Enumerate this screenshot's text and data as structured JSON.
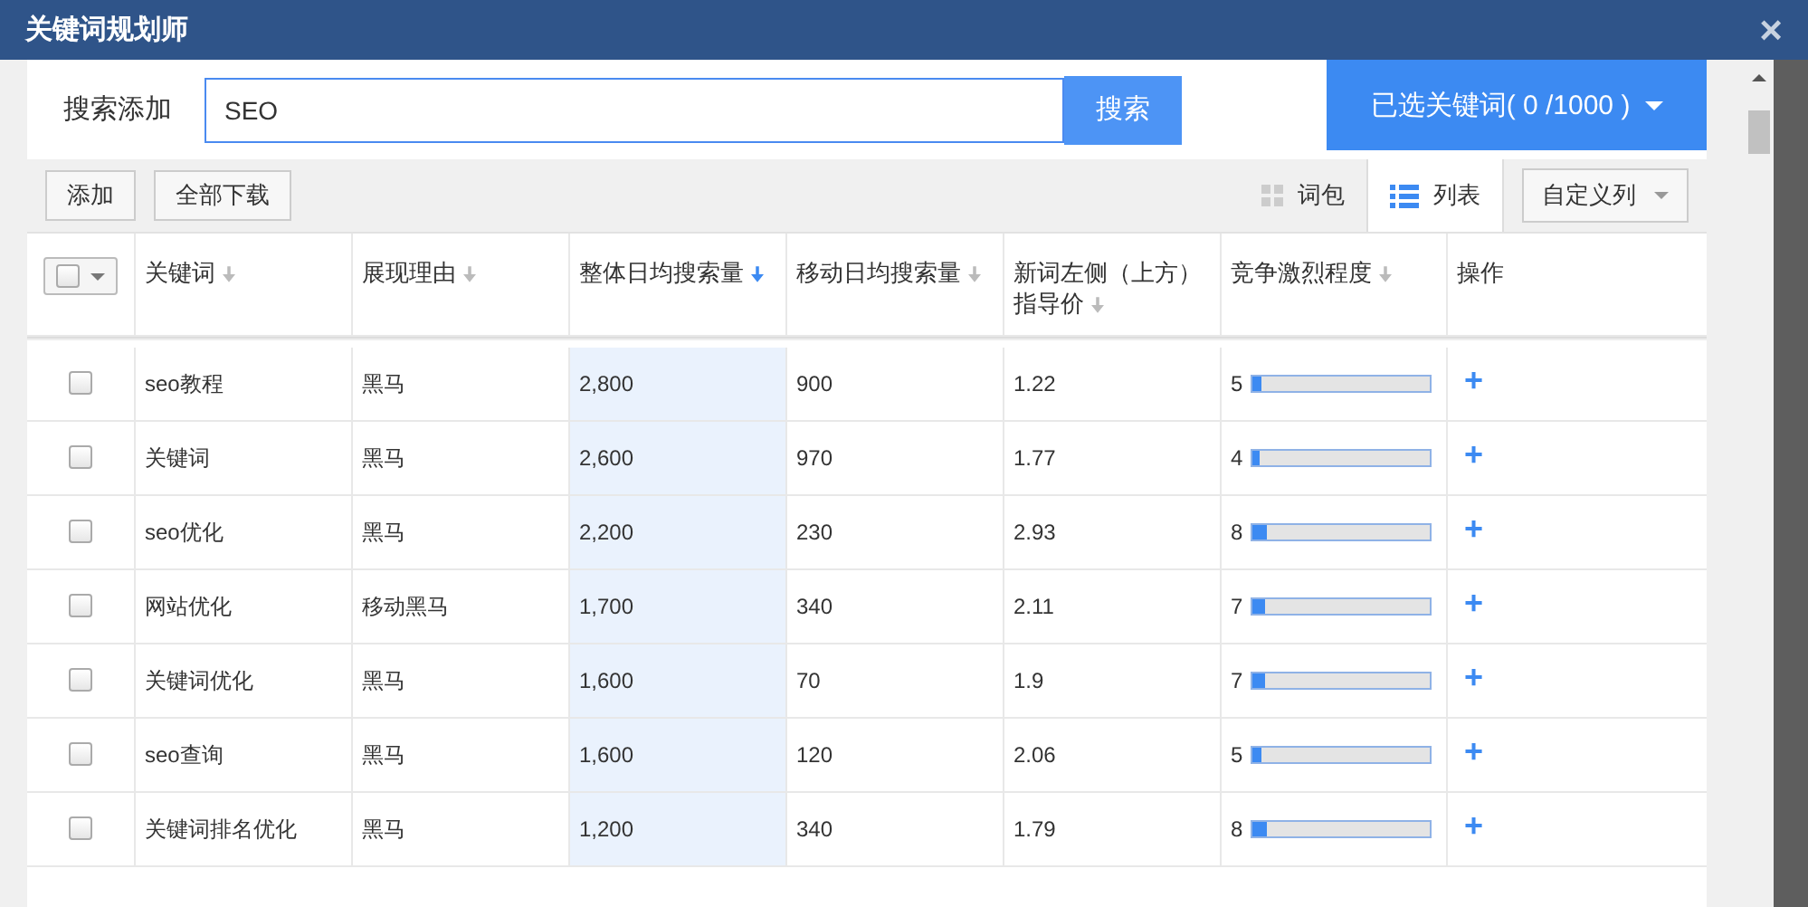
{
  "window": {
    "title": "关键词规划师",
    "close": "×"
  },
  "search": {
    "label": "搜索添加",
    "value": "SEO",
    "button": "搜索",
    "selected_summary": "已选关键词( 0 /1000 )"
  },
  "toolbar": {
    "buttons": [
      "添加",
      "全部下载"
    ],
    "views": [
      {
        "label": "词包",
        "kind": "grid",
        "selected": false
      },
      {
        "label": "列表",
        "kind": "list",
        "selected": true
      }
    ],
    "columns_menu": "自定义列"
  },
  "table": {
    "select_all": {
      "checked": false
    },
    "columns": [
      {
        "label": "关键词",
        "sortable": true,
        "sorted": false
      },
      {
        "label": "展现理由",
        "sortable": true,
        "sorted": false
      },
      {
        "label": "整体日均搜索量",
        "sortable": true,
        "sorted": true
      },
      {
        "label": "移动日均搜索量",
        "sortable": true,
        "sorted": false
      },
      {
        "label": "新词左侧（上方）指导价",
        "sortable": true,
        "sorted": false
      },
      {
        "label": "竞争激烈程度",
        "sortable": true,
        "sorted": false
      },
      {
        "label": "操作",
        "sortable": false
      }
    ],
    "rows": [
      {
        "checked": false,
        "keyword": "seo教程",
        "reason": "黑马",
        "total": "2,800",
        "mobile": "900",
        "price": "1.22",
        "competition": "5",
        "level": 0.05,
        "action": "+"
      },
      {
        "checked": false,
        "keyword": "关键词",
        "reason": "黑马",
        "total": "2,600",
        "mobile": "970",
        "price": "1.77",
        "competition": "4",
        "level": 0.04,
        "action": "+"
      },
      {
        "checked": false,
        "keyword": "seo优化",
        "reason": "黑马",
        "total": "2,200",
        "mobile": "230",
        "price": "2.93",
        "competition": "8",
        "level": 0.08,
        "action": "+"
      },
      {
        "checked": false,
        "keyword": "网站优化",
        "reason": "移动黑马",
        "total": "1,700",
        "mobile": "340",
        "price": "2.11",
        "competition": "7",
        "level": 0.07,
        "action": "+"
      },
      {
        "checked": false,
        "keyword": "关键词优化",
        "reason": "黑马",
        "total": "1,600",
        "mobile": "70",
        "price": "1.9",
        "competition": "7",
        "level": 0.07,
        "action": "+"
      },
      {
        "checked": false,
        "keyword": "seo查询",
        "reason": "黑马",
        "total": "1,600",
        "mobile": "120",
        "price": "2.06",
        "competition": "5",
        "level": 0.05,
        "action": "+"
      },
      {
        "checked": false,
        "keyword": "关键词排名优化",
        "reason": "黑马",
        "total": "1,200",
        "mobile": "340",
        "price": "1.79",
        "competition": "8",
        "level": 0.08,
        "action": "+"
      }
    ]
  }
}
